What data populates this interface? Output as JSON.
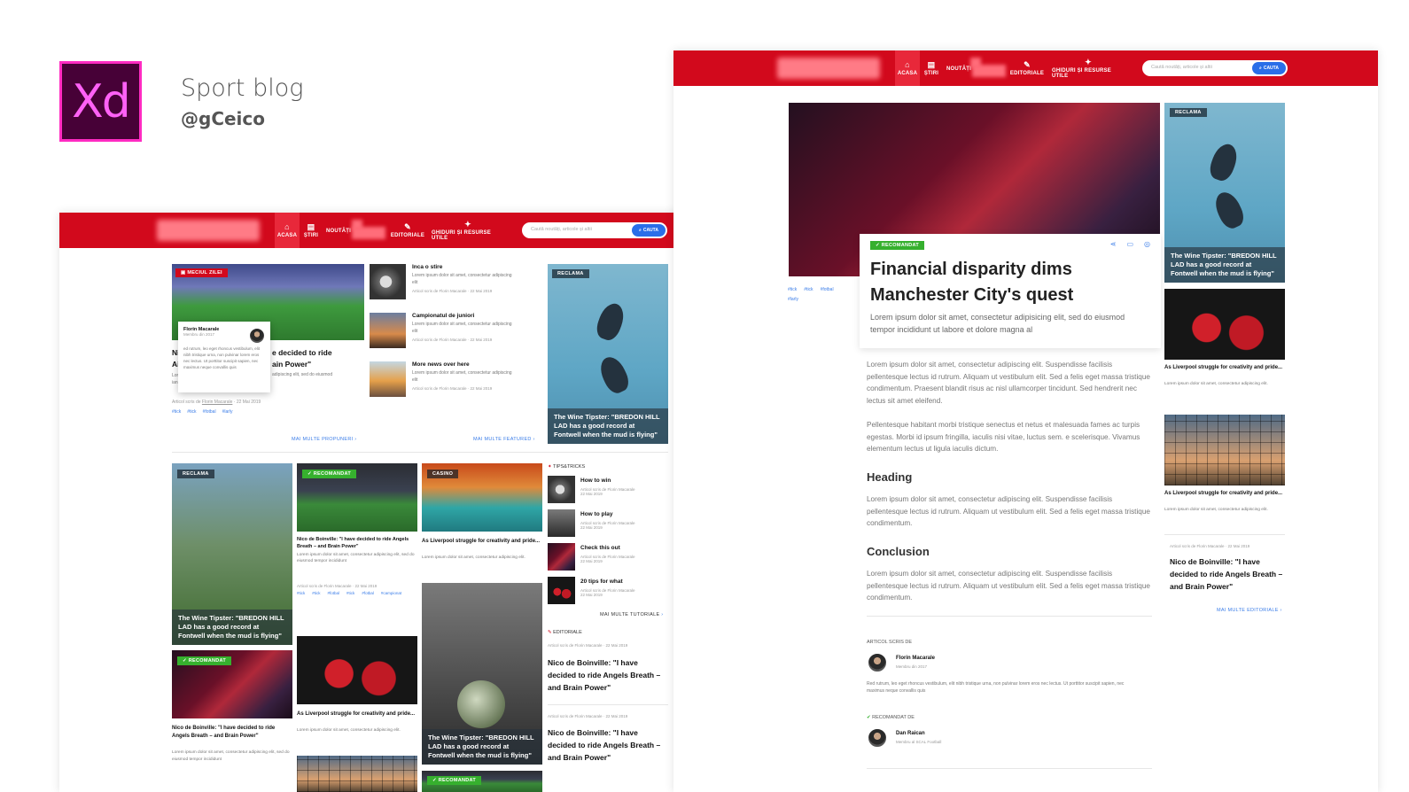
{
  "brand": {
    "app_badge": "Xd",
    "title": "Sport blog",
    "handle": "@gCeico"
  },
  "colors": {
    "nav_red": "#d2091c",
    "accent_blue": "#3b7de8",
    "recommended_green": "#36b02e",
    "xd_bg": "#470137",
    "xd_border": "#ff2bc2"
  },
  "nav": {
    "items": [
      {
        "icon": "home-icon",
        "glyph": "⌂",
        "label": "ACASA"
      },
      {
        "icon": "news-icon",
        "glyph": "▤",
        "label": "ȘTIRI"
      },
      {
        "icon": "",
        "glyph": "",
        "label": "NOUTĂȚI"
      },
      {
        "icon": "book-icon",
        "glyph": "✎",
        "label": "EDITORIALE"
      },
      {
        "icon": "bulb-icon",
        "glyph": "✦",
        "label": "GHIDURI ȘI RESURSE UTILE"
      }
    ],
    "search_placeholder": "Caută noutăți, articole și altii",
    "search_button": "CAUTA"
  },
  "left": {
    "featured": {
      "tag": "MECIUL ZILEI",
      "title_start": "Ni",
      "title_start2": "Ai",
      "title_rest1": "e decided to ride",
      "title_rest2": "ain Power\"",
      "excerpt_short": "Lor",
      "excerpt_short2": "ian",
      "excerpt_rest": "adipiscing elit, sed do eiusmod",
      "meta_prefix": "Articol scris de",
      "meta_author": "Florin Macarale",
      "meta_date": "· 22 Mai 2019",
      "tags": [
        "#tick",
        "#tick",
        "#fotbal",
        "#larly"
      ]
    },
    "popover": {
      "name": "Florin Macarale",
      "since": "Membru din 2017",
      "bio": "ed rutrum, leo eget rhoncus vestibulum, elit nibh tristique urna, non pulvinar lorem eros nec lectus. Ut porttitor suscipit sapien, nec maximus neque convallis quis"
    },
    "side_list": [
      {
        "title": "Inca o stire",
        "body": "Lorem ipsum dolor sit amet, consectetur adipiscing elit",
        "meta": "Articol scris de Florin Macarale · 22 Mai 2019"
      },
      {
        "title": "Campionatul de juniori",
        "body": "Lorem ipsum dolor sit amet, consectetur adipiscing elit",
        "meta": "Articol scris de Florin Macarale · 22 Mai 2019"
      },
      {
        "title": "More news over here",
        "body": "Lorem ipsum dolor sit amet, consectetur adipiscing elit",
        "meta": "Articol scris de Florin Macarale · 22 Mai 2019"
      }
    ],
    "ad": {
      "tag": "RECLAMA",
      "caption": "The Wine Tipster: \"BREDON HILL LAD has a good record at Fontwell when the mud is flying\""
    },
    "more_proposals": "MAI MULTE PROPUNERI",
    "more_featured": "MAI MULTE FEATURED",
    "grid": {
      "ad_player": {
        "tag": "RECLAMA",
        "caption": "The Wine Tipster: \"BREDON HILL LAD has a good record at Fontwell when the mud is flying\""
      },
      "rec_slots": {
        "tag": "RECOMANDAT",
        "title": "Nico de Boinville: \"I have decided to ride Angels Breath – and Brain Power\"",
        "body": "Lorem ipsum dolor sit amet, consectetur adipiscing elit, sed do eiusmod tempor incididunt"
      },
      "rec_stadium": {
        "tag": "RECOMANDAT",
        "title": "Nico de Boinville: \"I have decided to ride Angels Breath – and Brain Power\"",
        "body": "Lorem ipsum dolor sit amet, consectetur adipiscing elit, sed do eiusmod tempor incididunt",
        "meta": "Articol scris de Florin Macarale · 22 Mai 2019",
        "tags": [
          "#tick",
          "#tick",
          "#fotbal",
          "#tick",
          "#fotbal",
          "#campionat"
        ]
      },
      "dice": {
        "title": "As Liverpool struggle for creativity and pride...",
        "body": "Lorem ipsum dolor sit amet, consectetur adipiscing elit."
      },
      "casino": {
        "tag": "CASINO",
        "title": "As Liverpool struggle for creativity and pride...",
        "body": "Lorem ipsum dolor sit amet, consectetur adipiscing elit."
      },
      "ball": {
        "caption": "The Wine Tipster: \"BREDON HILL LAD has a good record at Fontwell when the mud is flying\""
      },
      "rec_bottom": {
        "tag": "RECOMANDAT"
      }
    },
    "tips": {
      "heading": "TIPS&TRICKS",
      "items": [
        {
          "title": "How to win",
          "meta1": "Articol scris de Florin Macarale",
          "meta2": "22 Mai 2019"
        },
        {
          "title": "How to play",
          "meta1": "Articol scris de Florin Macarale",
          "meta2": "22 Mai 2019"
        },
        {
          "title": "Check this out",
          "meta1": "Articol scris de Florin Macarale",
          "meta2": "22 Mai 2019"
        },
        {
          "title": "20 tips for what",
          "meta1": "Articol scris de Florin Macarale",
          "meta2": "22 Mai 2019"
        }
      ],
      "more": "MAI MULTE TUTORIALE"
    },
    "editorials": {
      "heading": "EDITORIALE",
      "items": [
        {
          "meta": "Articol scris de Florin Macarale · 22 Mai 2019",
          "title": "Nico de Boinville: \"I have decided to ride Angels Breath – and Brain Power\""
        },
        {
          "meta": "Articol scris de Florin Macarale · 22 Mai 2019",
          "title": "Nico de Boinville: \"I have decided to ride Angels Breath – and Brain Power\""
        }
      ]
    }
  },
  "right": {
    "article": {
      "tag": "RECOMANDAT",
      "title": "Financial disparity dims Manchester City's quest",
      "lead": "Lorem ipsum dolor sit amet, consectetur adipisicing elit, sed do eiusmod tempor incididunt ut labore et dolore magna al",
      "side_tags": [
        "#tick",
        "#tick",
        "#fotbal",
        "#larly"
      ],
      "p1": "Lorem ipsum dolor sit amet, consectetur adipiscing elit. Suspendisse facilisis pellentesque lectus id rutrum. Aliquam ut vestibulum elit. Sed a felis eget massa tristique condimentum. Praesent blandit risus ac nisl ullamcorper tincidunt. Sed hendrerit nec lectus sit amet eleifend.",
      "p2": "Pellentesque habitant morbi tristique senectus et netus et malesuada fames ac turpis egestas. Morbi id ipsum fringilla, iaculis nisi vitae, luctus sem. e scelerisque. Vivamus elementum lectus ut ligula iaculis dictum.",
      "h_heading": "Heading",
      "p3": "Lorem ipsum dolor sit amet, consectetur adipiscing elit. Suspendisse facilisis pellentesque lectus id rutrum. Aliquam ut vestibulum elit. Sed a felis eget massa tristique condimentum.",
      "h_conclusion": "Conclusion",
      "p4": "Lorem ipsum dolor sit amet, consectetur adipiscing elit. Suspendisse facilisis pellentesque lectus id rutrum. Aliquam ut vestibulum elit. Sed a felis eget massa tristique condimentum.",
      "author_label": "ARTICOL SCRIS DE",
      "author_name": "Florin Macarale",
      "author_since": "Membru din 2017",
      "author_bio": "Red rutrum, leo eget rhoncus vestibulum, elit nibh tristique urna, non pulvinar lorem eros nec lectus. Ut porttitor suscipit sapien, nec maximus neque convallis quis",
      "rec_label": "RECOMANDAT DE",
      "rec_name": "Dan Raican",
      "rec_role": "Membru al SCAL Football"
    },
    "sidebar": {
      "ad": {
        "tag": "RECLAMA",
        "caption": "The Wine Tipster: \"BREDON HILL LAD has a good record at Fontwell when the mud is flying\""
      },
      "card1": {
        "title": "As Liverpool struggle for creativity and pride...",
        "body": "Lorem ipsum dolor sit amet, consectetur adipiscing elit."
      },
      "card2": {
        "title": "As Liverpool struggle for creativity and pride...",
        "body": "Lorem ipsum dolor sit amet, consectetur adipiscing elit."
      },
      "editorial": {
        "meta": "Articol scris de Florin Macarale · 22 Mai 2019",
        "title": "Nico de Boinville: \"I have decided to ride Angels Breath – and Brain Power\""
      },
      "more": "MAI MULTE EDITORIALE"
    }
  }
}
